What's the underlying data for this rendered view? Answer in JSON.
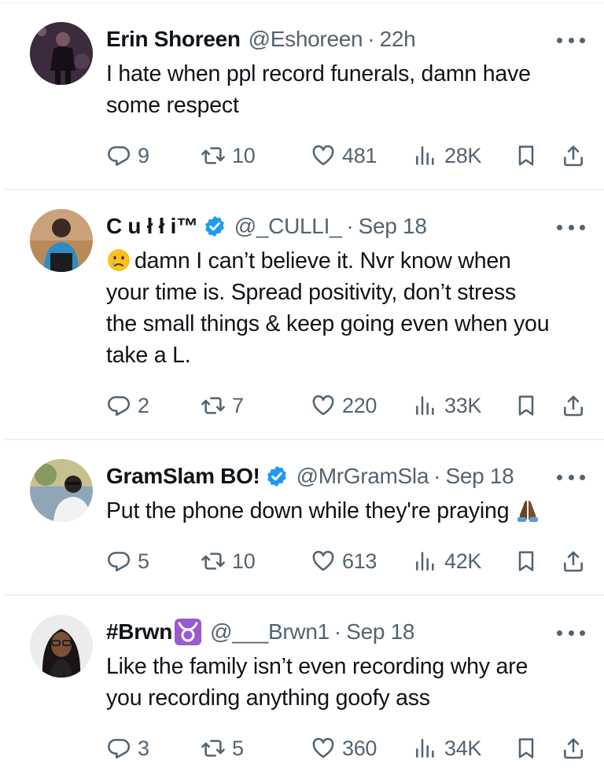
{
  "tweets": [
    {
      "name": "Erin Shoreen",
      "handle": "@Eshoreen",
      "separator": "·",
      "time": "22h",
      "verified": false,
      "lines": [
        "I hate when ppl record funerals, damn have",
        "some respect"
      ],
      "replies": "9",
      "retweets": "10",
      "likes": "481",
      "views": "28K"
    },
    {
      "name": "C u ł ł i™",
      "handle": "@_CULLI_",
      "separator": "·",
      "time": "Sep 18",
      "verified": true,
      "leading_emoji": "crying-face-emoji",
      "lines": [
        "damn I can’t believe it. Nvr know when",
        "your time is. Spread positivity, don’t stress",
        "the small things & keep going even when you",
        "take a L."
      ],
      "replies": "2",
      "retweets": "7",
      "likes": "220",
      "views": "33K"
    },
    {
      "name": "GramSlam BO!",
      "handle": "@MrGramSla",
      "separator": "·",
      "time": "Sep 18",
      "verified": true,
      "trailing_emoji": "folded-hands-emoji",
      "lines": [
        "Put the phone down while they're praying"
      ],
      "replies": "5",
      "retweets": "10",
      "likes": "613",
      "views": "42K"
    },
    {
      "name": "#Brwn",
      "name_emoji": "taurus-emoji",
      "handle": "@___Brwn1",
      "separator": "·",
      "time": "Sep 18",
      "verified": false,
      "lines": [
        "Like the family isn’t even recording why are",
        "you recording anything goofy ass"
      ],
      "replies": "3",
      "retweets": "5",
      "likes": "360",
      "views": "34K"
    }
  ],
  "colors": {
    "text": "#0f1419",
    "secondary": "#536471",
    "divider": "#eff3f4",
    "verified": "#1d9bf0",
    "taurus": "#9b59d0"
  }
}
